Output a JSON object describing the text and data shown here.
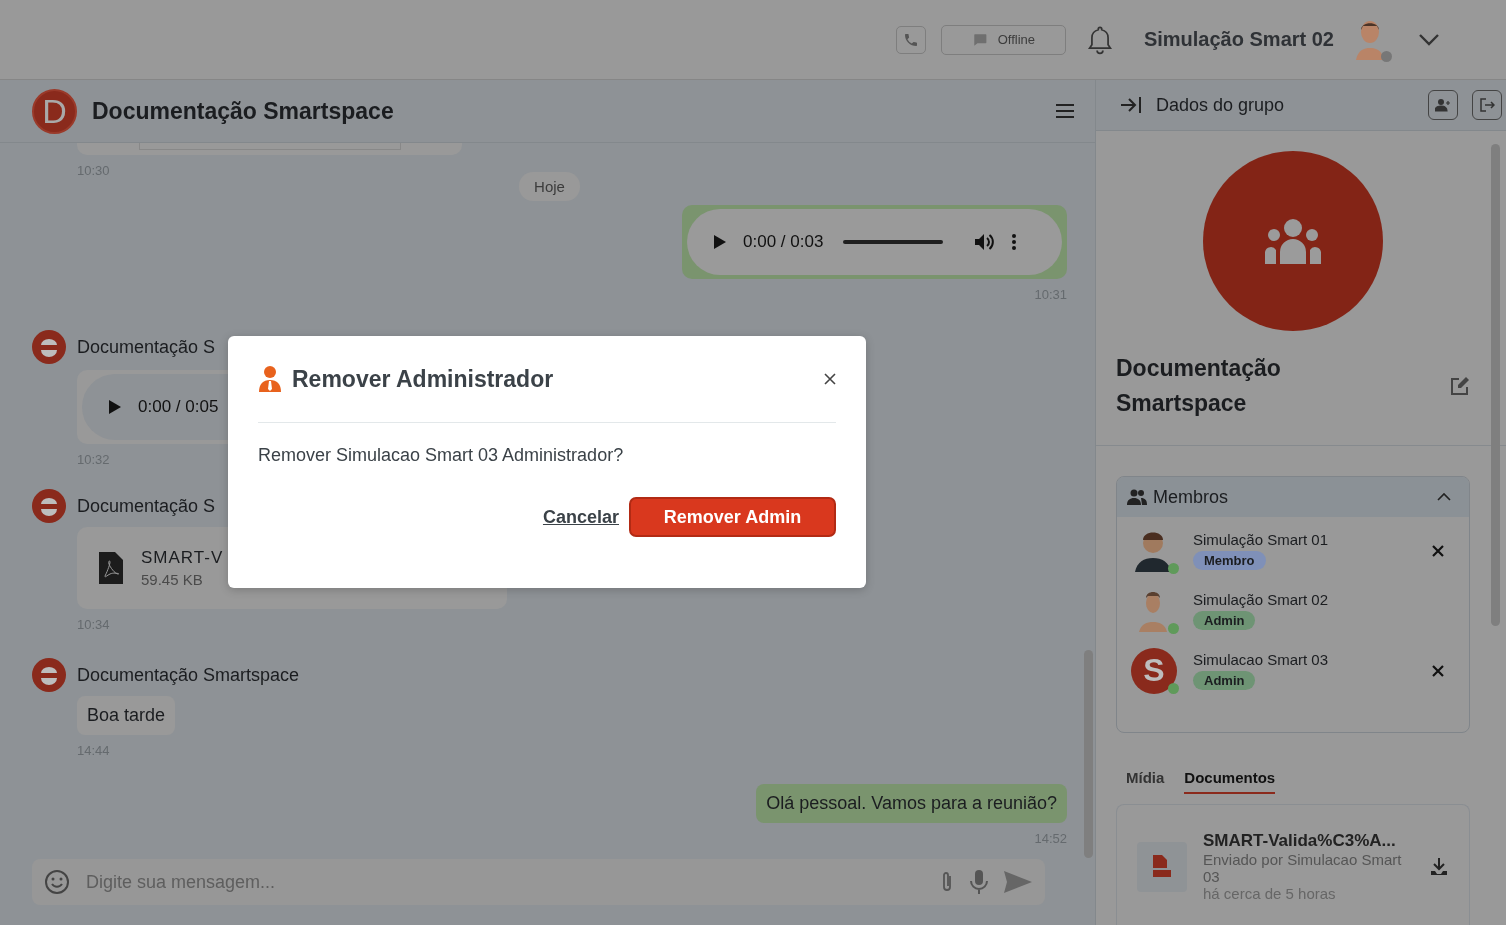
{
  "topbar": {
    "status_button": {
      "label": "Offline"
    },
    "user": {
      "name": "Simulação Smart 02",
      "online": false
    }
  },
  "chat": {
    "avatar_letter": "D",
    "title": "Documentação Smartspace",
    "messages": [
      {
        "kind": "preview",
        "outgoing": false,
        "time": "10:30"
      },
      {
        "kind": "date",
        "label": "Hoje"
      },
      {
        "kind": "audio",
        "outgoing": true,
        "position": "0:00 / 0:03",
        "time": "10:31"
      },
      {
        "kind": "audio",
        "outgoing": false,
        "sender": "Documentação S",
        "position": "0:00 / 0:05",
        "time": "10:32"
      },
      {
        "kind": "file",
        "outgoing": false,
        "sender": "Documentação S",
        "file_name": "SMART-V",
        "file_size": "59.45 KB",
        "time": "10:34"
      },
      {
        "kind": "text",
        "outgoing": false,
        "sender": "Documentação Smartspace",
        "text": "Boa tarde",
        "time": "14:44"
      },
      {
        "kind": "text",
        "outgoing": true,
        "text": "Olá pessoal. Vamos para a reunião?",
        "time": "14:52"
      }
    ],
    "input": {
      "placeholder": "Digite sua mensagem..."
    }
  },
  "panel": {
    "title": "Dados do grupo",
    "group_name": "Documentação Smartspace",
    "members_title": "Membros",
    "expanded": true,
    "members": [
      {
        "name": "Simulação Smart 01",
        "role": "Membro",
        "color": "#7f90b8",
        "online": true,
        "removable": true,
        "kind": "male"
      },
      {
        "name": "Simulação Smart 02",
        "role": "Admin",
        "color": "#6e9474",
        "online": true,
        "removable": false,
        "kind": "female"
      },
      {
        "name": "Simulacao Smart 03",
        "role": "Admin",
        "color": "#6e9474",
        "online": true,
        "removable": true,
        "kind": "letter",
        "initial": "S"
      }
    ],
    "tabs": [
      {
        "label": "Mídia",
        "selected": false
      },
      {
        "label": "Documentos",
        "selected": true
      }
    ],
    "documents": [
      {
        "name": "SMART-Valida%C3%A...",
        "sender": "Enviado por Simulacao Smart 03",
        "time": "há cerca de 5 horas"
      }
    ]
  },
  "dialog": {
    "title": "Remover Administrador",
    "message": "Remover Simulacao Smart 03 Administrador?",
    "buttons": [
      {
        "label": "Cancelar",
        "kind": "link"
      },
      {
        "label": "Remover Admin",
        "kind": "primary"
      }
    ]
  }
}
